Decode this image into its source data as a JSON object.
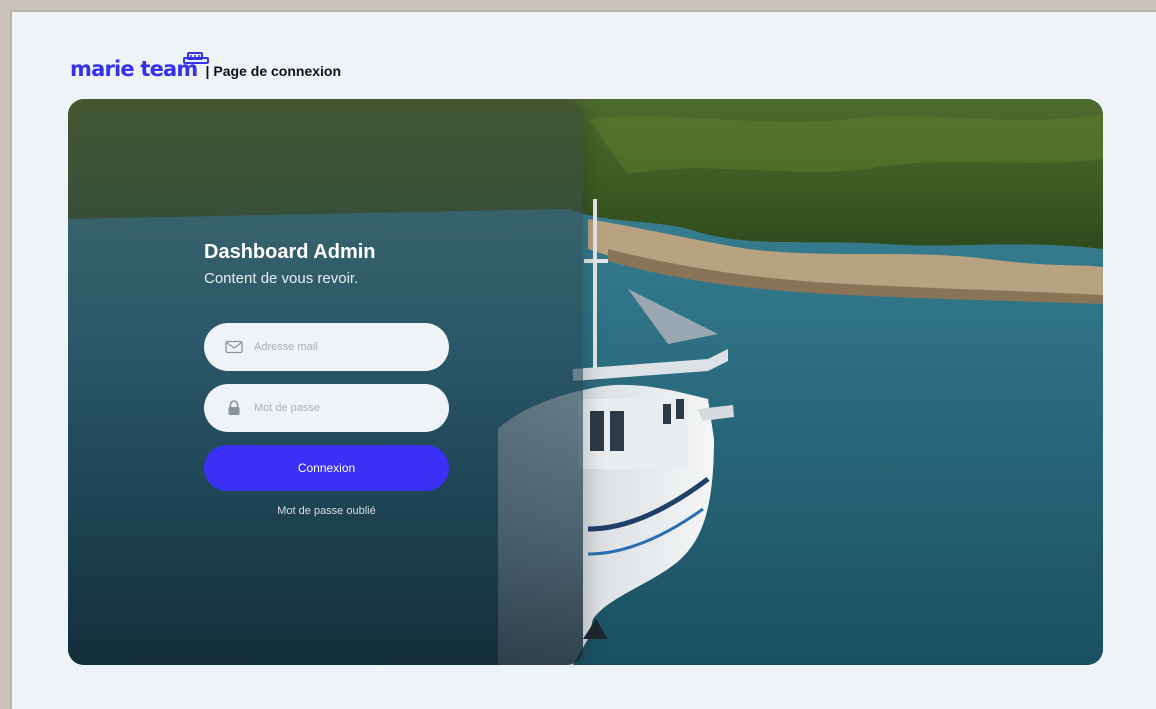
{
  "header": {
    "logo_text": "marie team",
    "separator": "|",
    "page_title": "Page de connexion"
  },
  "login": {
    "title": "Dashboard Admin",
    "subtitle": "Content de vous revoir.",
    "email_placeholder": "Adresse mail",
    "password_placeholder": "Mot de passe",
    "submit_label": "Connexion",
    "forgot_label": "Mot de passe oublié"
  },
  "colors": {
    "brand": "#3431e8",
    "button": "#3a2ff4",
    "page_bg": "#eef3f8"
  },
  "icons": {
    "email": "envelope-icon",
    "password": "lock-icon",
    "logo": "boat-icon"
  }
}
